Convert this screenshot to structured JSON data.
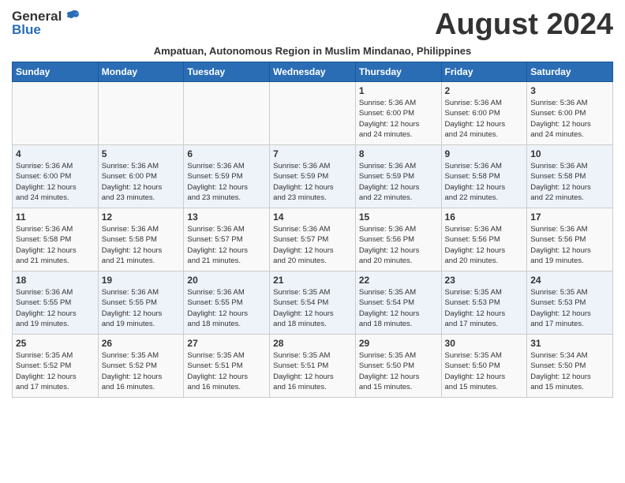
{
  "header": {
    "logo_general": "General",
    "logo_blue": "Blue",
    "month_title": "August 2024",
    "subtitle": "Ampatuan, Autonomous Region in Muslim Mindanao, Philippines"
  },
  "days_of_week": [
    "Sunday",
    "Monday",
    "Tuesday",
    "Wednesday",
    "Thursday",
    "Friday",
    "Saturday"
  ],
  "weeks": [
    [
      {
        "day": "",
        "info": ""
      },
      {
        "day": "",
        "info": ""
      },
      {
        "day": "",
        "info": ""
      },
      {
        "day": "",
        "info": ""
      },
      {
        "day": "1",
        "info": "Sunrise: 5:36 AM\nSunset: 6:00 PM\nDaylight: 12 hours\nand 24 minutes."
      },
      {
        "day": "2",
        "info": "Sunrise: 5:36 AM\nSunset: 6:00 PM\nDaylight: 12 hours\nand 24 minutes."
      },
      {
        "day": "3",
        "info": "Sunrise: 5:36 AM\nSunset: 6:00 PM\nDaylight: 12 hours\nand 24 minutes."
      }
    ],
    [
      {
        "day": "4",
        "info": "Sunrise: 5:36 AM\nSunset: 6:00 PM\nDaylight: 12 hours\nand 24 minutes."
      },
      {
        "day": "5",
        "info": "Sunrise: 5:36 AM\nSunset: 6:00 PM\nDaylight: 12 hours\nand 23 minutes."
      },
      {
        "day": "6",
        "info": "Sunrise: 5:36 AM\nSunset: 5:59 PM\nDaylight: 12 hours\nand 23 minutes."
      },
      {
        "day": "7",
        "info": "Sunrise: 5:36 AM\nSunset: 5:59 PM\nDaylight: 12 hours\nand 23 minutes."
      },
      {
        "day": "8",
        "info": "Sunrise: 5:36 AM\nSunset: 5:59 PM\nDaylight: 12 hours\nand 22 minutes."
      },
      {
        "day": "9",
        "info": "Sunrise: 5:36 AM\nSunset: 5:58 PM\nDaylight: 12 hours\nand 22 minutes."
      },
      {
        "day": "10",
        "info": "Sunrise: 5:36 AM\nSunset: 5:58 PM\nDaylight: 12 hours\nand 22 minutes."
      }
    ],
    [
      {
        "day": "11",
        "info": "Sunrise: 5:36 AM\nSunset: 5:58 PM\nDaylight: 12 hours\nand 21 minutes."
      },
      {
        "day": "12",
        "info": "Sunrise: 5:36 AM\nSunset: 5:58 PM\nDaylight: 12 hours\nand 21 minutes."
      },
      {
        "day": "13",
        "info": "Sunrise: 5:36 AM\nSunset: 5:57 PM\nDaylight: 12 hours\nand 21 minutes."
      },
      {
        "day": "14",
        "info": "Sunrise: 5:36 AM\nSunset: 5:57 PM\nDaylight: 12 hours\nand 20 minutes."
      },
      {
        "day": "15",
        "info": "Sunrise: 5:36 AM\nSunset: 5:56 PM\nDaylight: 12 hours\nand 20 minutes."
      },
      {
        "day": "16",
        "info": "Sunrise: 5:36 AM\nSunset: 5:56 PM\nDaylight: 12 hours\nand 20 minutes."
      },
      {
        "day": "17",
        "info": "Sunrise: 5:36 AM\nSunset: 5:56 PM\nDaylight: 12 hours\nand 19 minutes."
      }
    ],
    [
      {
        "day": "18",
        "info": "Sunrise: 5:36 AM\nSunset: 5:55 PM\nDaylight: 12 hours\nand 19 minutes."
      },
      {
        "day": "19",
        "info": "Sunrise: 5:36 AM\nSunset: 5:55 PM\nDaylight: 12 hours\nand 19 minutes."
      },
      {
        "day": "20",
        "info": "Sunrise: 5:36 AM\nSunset: 5:55 PM\nDaylight: 12 hours\nand 18 minutes."
      },
      {
        "day": "21",
        "info": "Sunrise: 5:35 AM\nSunset: 5:54 PM\nDaylight: 12 hours\nand 18 minutes."
      },
      {
        "day": "22",
        "info": "Sunrise: 5:35 AM\nSunset: 5:54 PM\nDaylight: 12 hours\nand 18 minutes."
      },
      {
        "day": "23",
        "info": "Sunrise: 5:35 AM\nSunset: 5:53 PM\nDaylight: 12 hours\nand 17 minutes."
      },
      {
        "day": "24",
        "info": "Sunrise: 5:35 AM\nSunset: 5:53 PM\nDaylight: 12 hours\nand 17 minutes."
      }
    ],
    [
      {
        "day": "25",
        "info": "Sunrise: 5:35 AM\nSunset: 5:52 PM\nDaylight: 12 hours\nand 17 minutes."
      },
      {
        "day": "26",
        "info": "Sunrise: 5:35 AM\nSunset: 5:52 PM\nDaylight: 12 hours\nand 16 minutes."
      },
      {
        "day": "27",
        "info": "Sunrise: 5:35 AM\nSunset: 5:51 PM\nDaylight: 12 hours\nand 16 minutes."
      },
      {
        "day": "28",
        "info": "Sunrise: 5:35 AM\nSunset: 5:51 PM\nDaylight: 12 hours\nand 16 minutes."
      },
      {
        "day": "29",
        "info": "Sunrise: 5:35 AM\nSunset: 5:50 PM\nDaylight: 12 hours\nand 15 minutes."
      },
      {
        "day": "30",
        "info": "Sunrise: 5:35 AM\nSunset: 5:50 PM\nDaylight: 12 hours\nand 15 minutes."
      },
      {
        "day": "31",
        "info": "Sunrise: 5:34 AM\nSunset: 5:50 PM\nDaylight: 12 hours\nand 15 minutes."
      }
    ]
  ]
}
